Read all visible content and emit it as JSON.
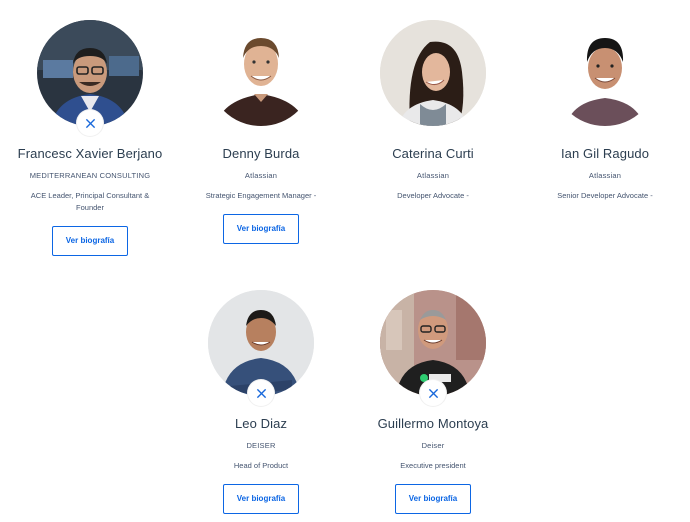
{
  "colors": {
    "accent": "#0c66e4",
    "text": "#2c3e50",
    "muted": "#44546f"
  },
  "speakers": [
    {
      "name": "Francesc Xavier Berjano",
      "company": "MEDITERRANEAN CONSULTING",
      "role": "ACE Leader, Principal Consultant & Founder",
      "button": "Ver biografía",
      "twitter_icon": "x-icon"
    },
    {
      "name": "Denny Burda",
      "company": "Atlassian",
      "role": "Strategic Engagement Manager -",
      "button": "Ver biografía"
    },
    {
      "name": "Caterina Curti",
      "company": "Atlassian",
      "role": "Developer Advocate -"
    },
    {
      "name": "Ian Gil Ragudo",
      "company": "Atlassian",
      "role": "Senior Developer Advocate -"
    },
    {
      "name": "Leo Diaz",
      "company": "DEISER",
      "role": "Head of Product",
      "button": "Ver biografía",
      "twitter_icon": "x-icon"
    },
    {
      "name": "Guillermo Montoya",
      "company": "Deiser",
      "role": "Executive president",
      "button": "Ver biografía",
      "twitter_icon": "x-icon"
    }
  ]
}
